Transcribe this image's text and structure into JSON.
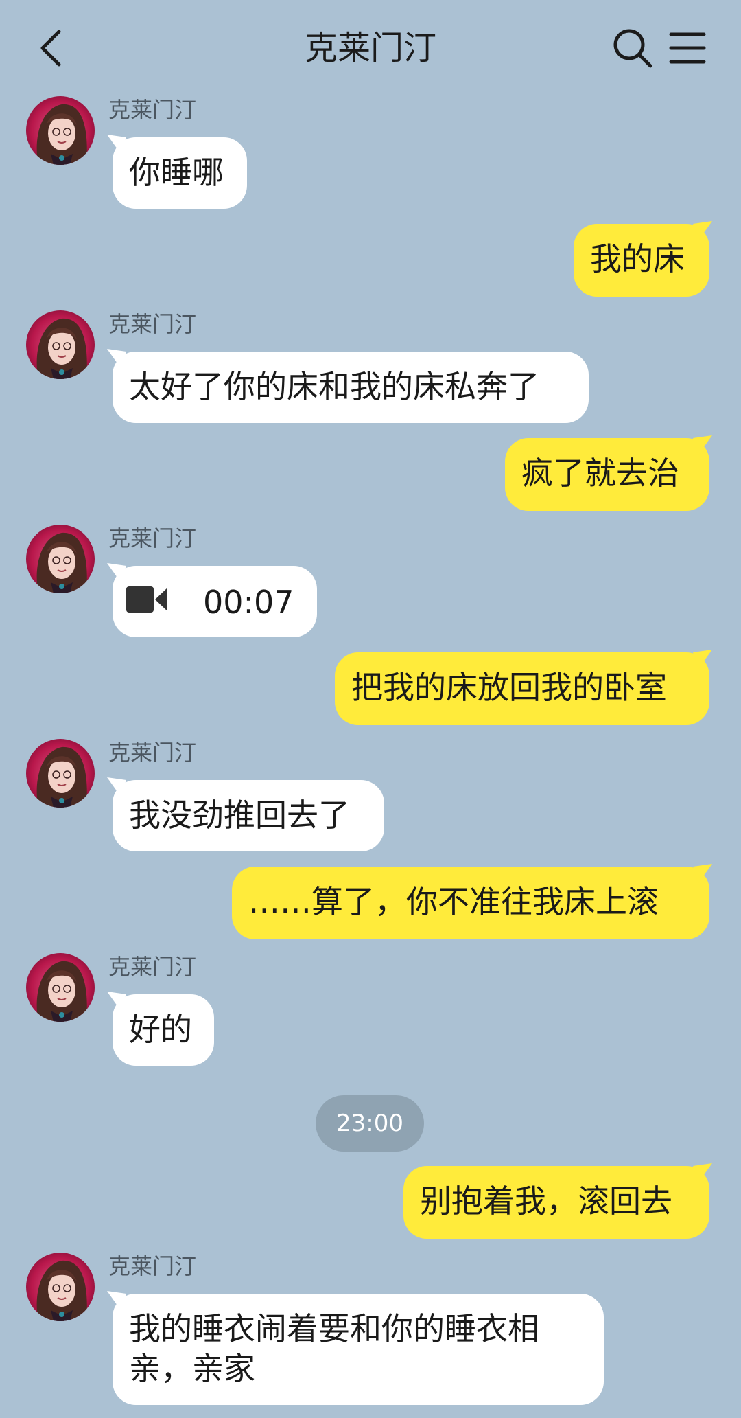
{
  "header": {
    "title": "克莱门汀"
  },
  "messages": {
    "m1": {
      "sender": "克莱门汀",
      "text": "你睡哪"
    },
    "m2": {
      "text": "我的床"
    },
    "m3": {
      "sender": "克莱门汀",
      "text": "太好了你的床和我的床私奔了"
    },
    "m4": {
      "text": "疯了就去治"
    },
    "m5": {
      "sender": "克莱门汀",
      "duration": "00:07",
      "icon": "video-camera-icon"
    },
    "m6": {
      "text": "把我的床放回我的卧室"
    },
    "m7": {
      "sender": "克莱门汀",
      "text": "我没劲推回去了"
    },
    "m8": {
      "text": "……算了，你不准往我床上滚"
    },
    "m9": {
      "sender": "克莱门汀",
      "text": "好的"
    },
    "timestamp": "23:00",
    "m10": {
      "text": "别抱着我，滚回去"
    },
    "m11": {
      "sender": "克莱门汀",
      "line1": "我的睡衣闹着要和你的睡衣相",
      "line2": "亲，亲家"
    }
  },
  "colors": {
    "background": "#abc1d3",
    "incoming_bubble": "#ffffff",
    "outgoing_bubble": "#ffeb3b"
  }
}
